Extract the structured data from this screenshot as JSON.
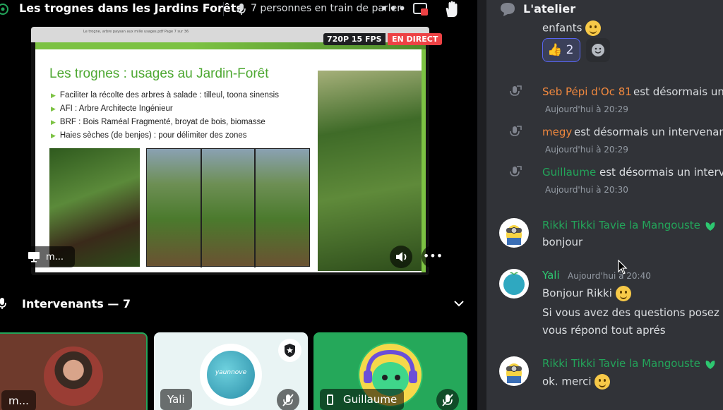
{
  "stage": {
    "title": "Les trognes dans les Jardins Forêts",
    "speaking": "7 personnes en train de parler",
    "more": "•••"
  },
  "video": {
    "toolbar_text": "Le trogne, arbre paysan aux mille usages.pdf   Page 7 sur 36",
    "resolution_badge": "720P 15 FPS",
    "live_badge": "EN DIRECT",
    "presenter_label": "m...",
    "more": "•••"
  },
  "slide": {
    "title": "Les trognes : usages au Jardin-Forêt",
    "bullets": [
      "Faciliter la récolte des arbres à salade : tilleul, toona sinensis",
      "AFI : Arbre Architecte Ingénieur",
      "BRF : Bois Raméal Fragmenté, broyat de bois, biomasse",
      "Haies sèches (de benjes) : pour délimiter des zones"
    ]
  },
  "speakers": {
    "label": "Intervenants — 7",
    "tiles": [
      {
        "name": "m..."
      },
      {
        "name": "Yali",
        "logo_text": "yaunnove"
      },
      {
        "name": "Guillaume"
      }
    ]
  },
  "chat": {
    "title": "L'atelier",
    "messages": [
      {
        "text": "enfants"
      },
      {
        "reaction_count": "2"
      },
      {
        "author": "Seb Pépi d'Oc 81",
        "text": "est désormais un",
        "time": "Aujourd'hui à 20:29",
        "color": "#f0883e"
      },
      {
        "author": "megy",
        "text": "est désormais un intervenant",
        "time": "Aujourd'hui à 20:29",
        "color": "#f0883e"
      },
      {
        "author": "Guillaume",
        "text": "est désormais un interv",
        "time": "Aujourd'hui à 20:30",
        "color": "#23a55a"
      },
      {
        "author": "Rikki Tikki Tavie la Mangouste",
        "text": "bonjour",
        "color": "#23a55a"
      },
      {
        "author": "Yali",
        "time": "Aujourd'hui à 20:40",
        "text": "Bonjour Rikki",
        "line2": "Si vous avez des questions posez le",
        "line3": "vous répond tout aprés",
        "color": "#2dc770"
      },
      {
        "author": "Rikki Tikki Tavie la Mangouste",
        "text": "ok. merci",
        "color": "#23a55a"
      }
    ]
  },
  "colors": {
    "accent_green": "#23a55a",
    "live_red": "#ed4245",
    "chat_bg": "#313338",
    "blurple": "#5865f2"
  }
}
